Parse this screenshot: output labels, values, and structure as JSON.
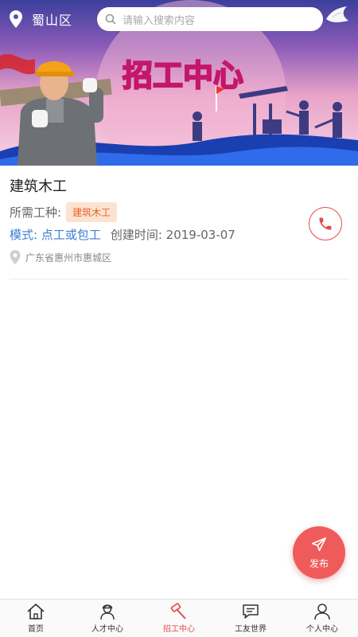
{
  "header": {
    "location": "蜀山区",
    "search_placeholder": "请输入搜索内容"
  },
  "banner": {
    "title": "招工中心"
  },
  "job": {
    "title": "建筑木工",
    "trade_label": "所需工种:",
    "trade_tag": "建筑木工",
    "mode": "模式: 点工或包工",
    "created": "创建时间: 2019-03-07",
    "address": "广东省惠州市惠城区"
  },
  "fab": {
    "label": "发布"
  },
  "nav": {
    "items": [
      {
        "label": "首页",
        "icon": "home-icon"
      },
      {
        "label": "人才中心",
        "icon": "worker-icon"
      },
      {
        "label": "招工中心",
        "icon": "hammer-icon",
        "active": true
      },
      {
        "label": "工友世界",
        "icon": "chat-icon"
      },
      {
        "label": "个人中心",
        "icon": "person-icon"
      }
    ]
  },
  "colors": {
    "accent": "#e14b4b",
    "mode_text": "#3a7fd0",
    "tag_bg": "#fde3cf",
    "tag_text": "#e2652c"
  }
}
